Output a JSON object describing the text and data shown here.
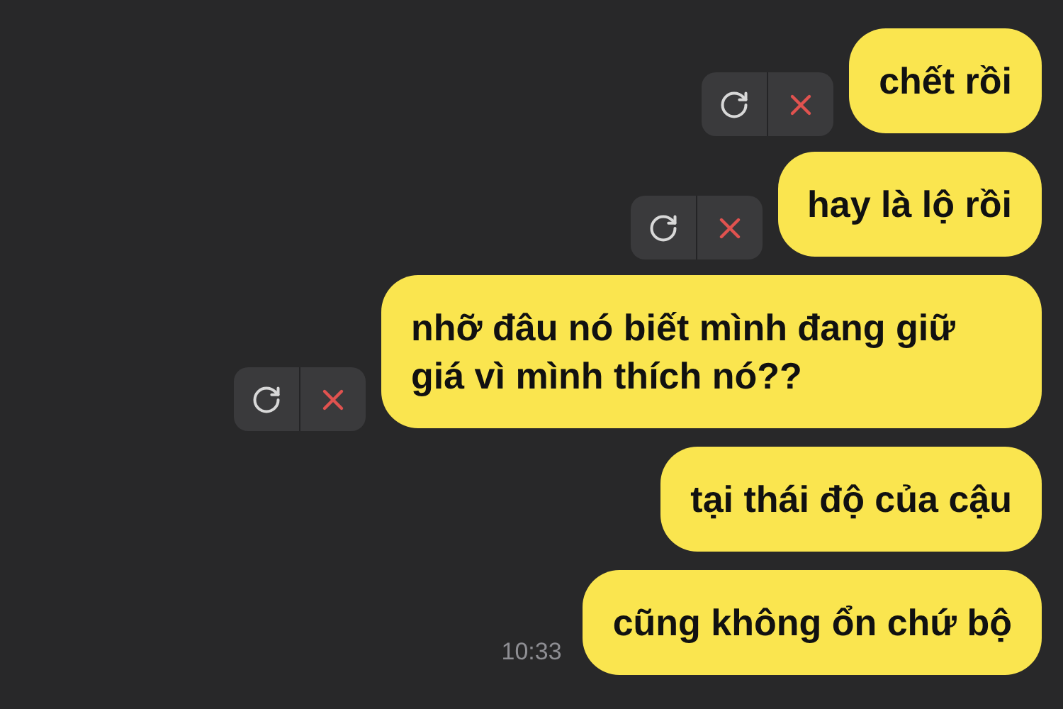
{
  "messages": [
    {
      "text": "chết rồi",
      "failed": true
    },
    {
      "text": "hay là lộ rồi",
      "failed": true
    },
    {
      "text": "nhỡ đâu nó biết mình đang giữ giá vì mình thích nó??",
      "failed": true
    },
    {
      "text": "tại thái độ của cậu",
      "failed": false
    },
    {
      "text": "cũng không ổn chứ bộ",
      "failed": false,
      "time": "10:33"
    }
  ]
}
